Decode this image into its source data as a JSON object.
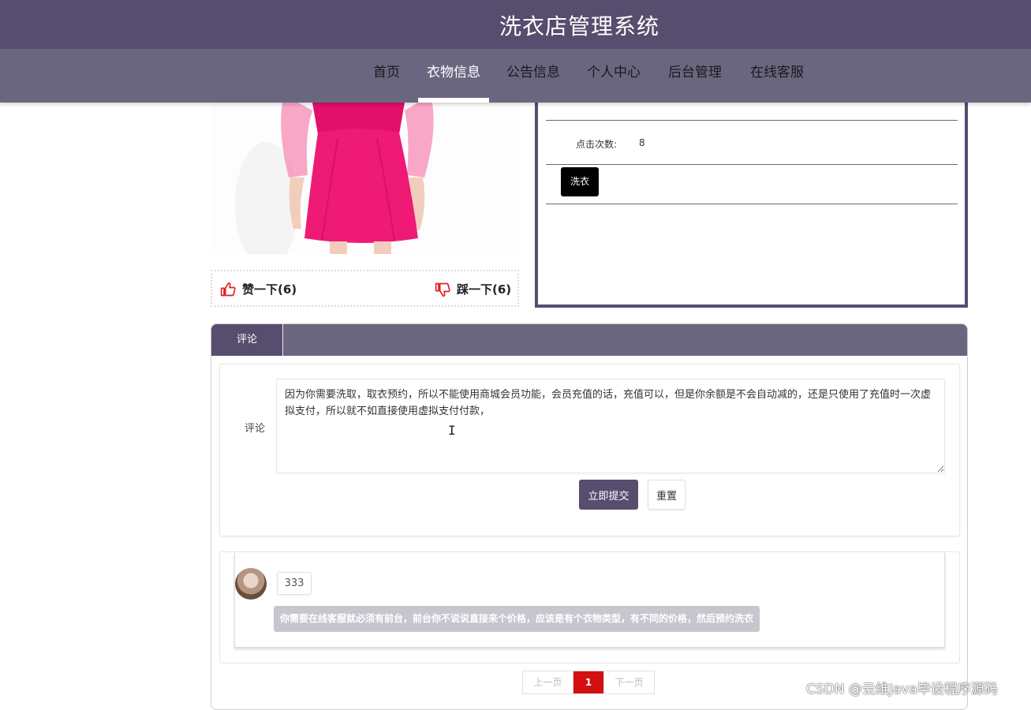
{
  "header": {
    "title": "洗衣店管理系统"
  },
  "nav": {
    "items": [
      {
        "label": "首页"
      },
      {
        "label": "衣物信息",
        "active": true
      },
      {
        "label": "公告信息"
      },
      {
        "label": "个人中心"
      },
      {
        "label": "后台管理"
      },
      {
        "label": "在线客服"
      }
    ]
  },
  "product": {
    "likes_label": "赞一下(6)",
    "dislikes_label": "踩一下(6)"
  },
  "info": {
    "clicks_label": "点击次数:",
    "clicks_value": "8",
    "wash_button": "洗衣"
  },
  "comments": {
    "tab_label": "评论",
    "form_label": "评论",
    "textarea_value": "因为你需要洗取，取衣预约，所以不能使用商城会员功能，会员充值的话，充值可以，但是你余额是不会自动减的，还是只使用了充值时一次虚拟支付，所以就不如直接使用虚拟支付付款，",
    "submit_label": "立即提交",
    "reset_label": "重置",
    "items": [
      {
        "username": "333",
        "reply": "你需要在线客服就必须有前台，前台你不说说直接来个价格，应该是有个衣物类型，有不同的价格，然后预约洗衣"
      }
    ]
  },
  "pagination": {
    "prev": "上一页",
    "current": "1",
    "next": "下一页"
  },
  "watermark": "CSDN @云维Java毕设程序源码",
  "colors": {
    "primary": "#574d6e",
    "nav": "#6b6680",
    "page_current": "#d40f0f"
  }
}
